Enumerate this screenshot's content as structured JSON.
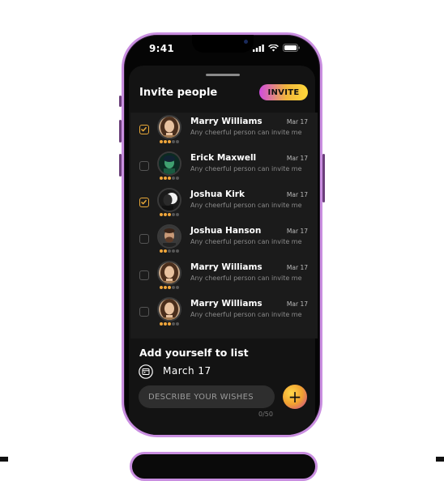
{
  "status_bar": {
    "time": "9:41"
  },
  "sheet": {
    "title": "Invite people",
    "invite_button": "INVITE"
  },
  "people": [
    {
      "name": "Marry Williams",
      "subtitle": "Any cheerful person can invite me",
      "date": "Mar 17",
      "checked": true,
      "rating": 3,
      "avatar": "woman-avatar"
    },
    {
      "name": "Erick Maxwell",
      "subtitle": "Any cheerful person can invite me",
      "date": "Mar 17",
      "checked": false,
      "rating": 3,
      "avatar": "man-green-avatar"
    },
    {
      "name": "Joshua Kirk",
      "subtitle": "Any cheerful person can invite me",
      "date": "Mar 17",
      "checked": true,
      "rating": 3,
      "avatar": "man-dark-avatar"
    },
    {
      "name": "Joshua Hanson",
      "subtitle": "Any cheerful person can invite me",
      "date": "Mar 17",
      "checked": false,
      "rating": 2,
      "avatar": "man-beard-avatar"
    },
    {
      "name": "Marry Williams",
      "subtitle": "Any cheerful person can invite me",
      "date": "Mar 17",
      "checked": false,
      "rating": 3,
      "avatar": "woman-avatar"
    },
    {
      "name": "Marry Williams",
      "subtitle": "Any cheerful person can invite me",
      "date": "Mar 17",
      "checked": false,
      "rating": 3,
      "avatar": "woman-avatar"
    }
  ],
  "add_section": {
    "title": "Add yourself to list",
    "date": "March  17",
    "wish_placeholder": "DESCRIBE YOUR WISHES",
    "counter": "0/50",
    "add_button": "+"
  },
  "colors": {
    "accent_check": "#e8a838",
    "frame": "#c98ee0",
    "star_on": "#f0a63a"
  }
}
